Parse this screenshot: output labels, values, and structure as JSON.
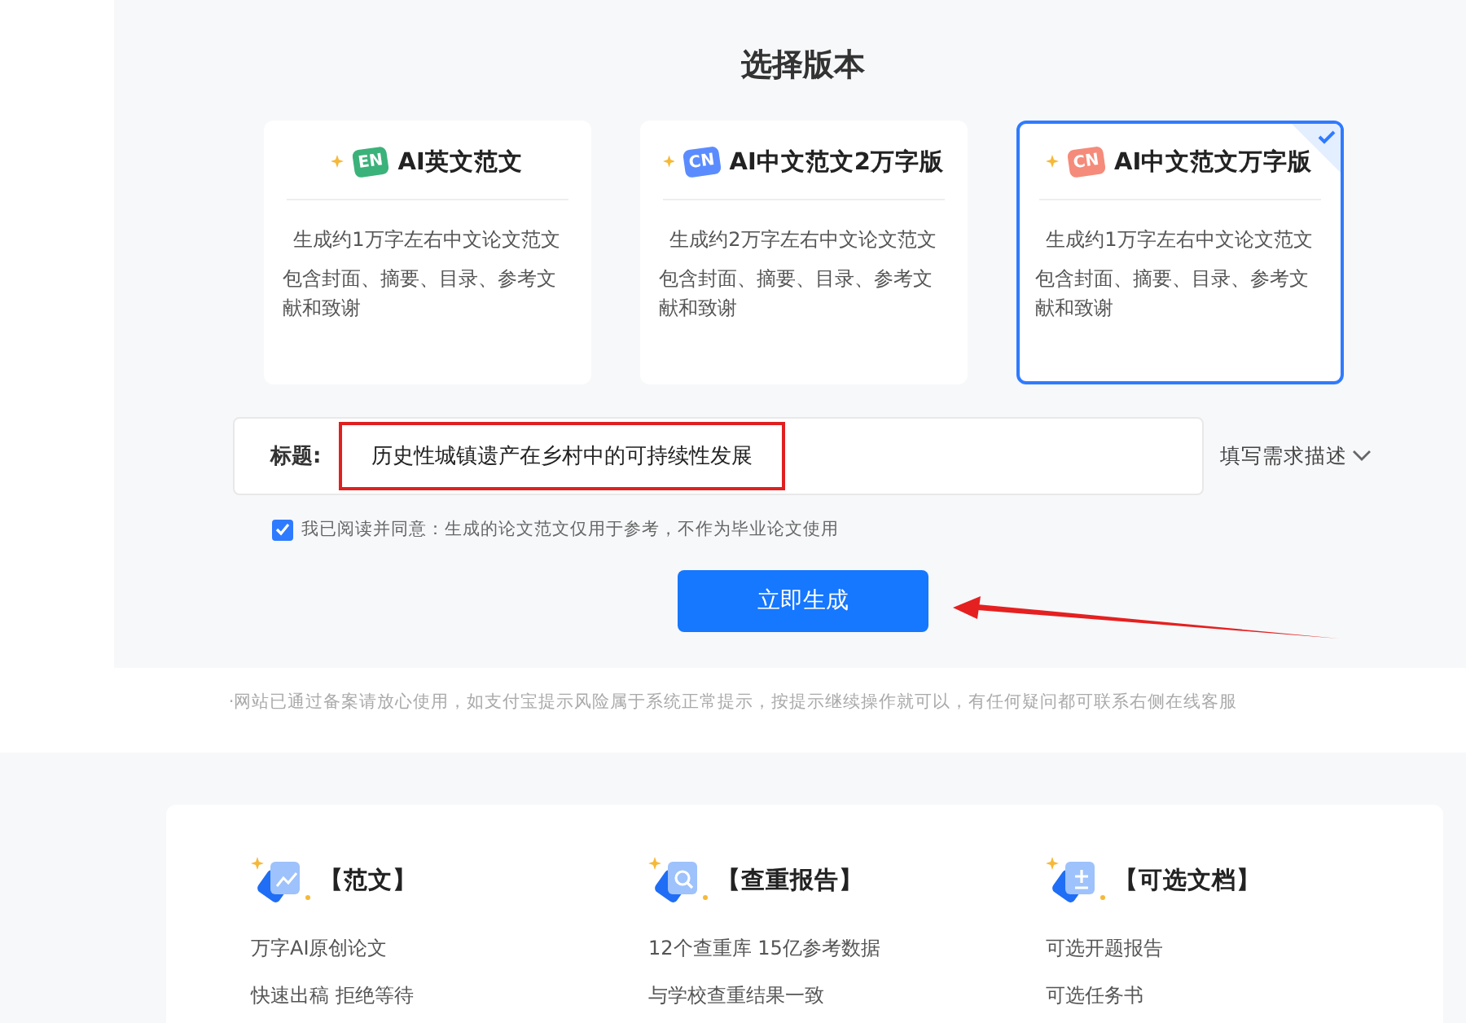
{
  "heading": "选择版本",
  "cards": [
    {
      "badge": "EN",
      "color": "#3bb27a",
      "title": "AI英文范文",
      "selected": false,
      "lines": [
        "生成约1万字左右中文论文范文",
        "包含封面、摘要、目录、参考文献和致谢"
      ]
    },
    {
      "badge": "CN",
      "color": "#5b8cff",
      "title": "AI中文范文2万字版",
      "selected": false,
      "lines": [
        "生成约2万字左右中文论文范文",
        "包含封面、摘要、目录、参考文献和致谢"
      ]
    },
    {
      "badge": "CN",
      "color": "#f58b7a",
      "title": "AI中文范文万字版",
      "selected": true,
      "lines": [
        "生成约1万字左右中文论文范文",
        "包含封面、摘要、目录、参考文献和致谢"
      ]
    }
  ],
  "title_field": {
    "label": "标题:",
    "value": "历史性城镇遗产在乡村中的可持续性发展"
  },
  "describe_toggle": {
    "label": "填写需求描述",
    "expanded": false
  },
  "agreement": {
    "checked": true,
    "text": "我已阅读并同意：生成的论文范文仅用于参考，不作为毕业论文使用"
  },
  "generate_button": "立即生成",
  "notice": "·网站已通过备案请放心使用，如支付宝提示风险属于系统正常提示，按提示继续操作就可以，有任何疑问都可联系右侧在线客服",
  "features": [
    {
      "kind": "chart",
      "title": "【范文】",
      "lines": [
        "万字AI原创论文",
        "快速出稿 拒绝等待"
      ]
    },
    {
      "kind": "search",
      "title": "【查重报告】",
      "lines": [
        "12个查重库 15亿参考数据",
        "与学校查重结果一致"
      ]
    },
    {
      "kind": "plus",
      "title": "【可选文档】",
      "lines": [
        "可选开题报告",
        "可选任务书"
      ]
    }
  ]
}
